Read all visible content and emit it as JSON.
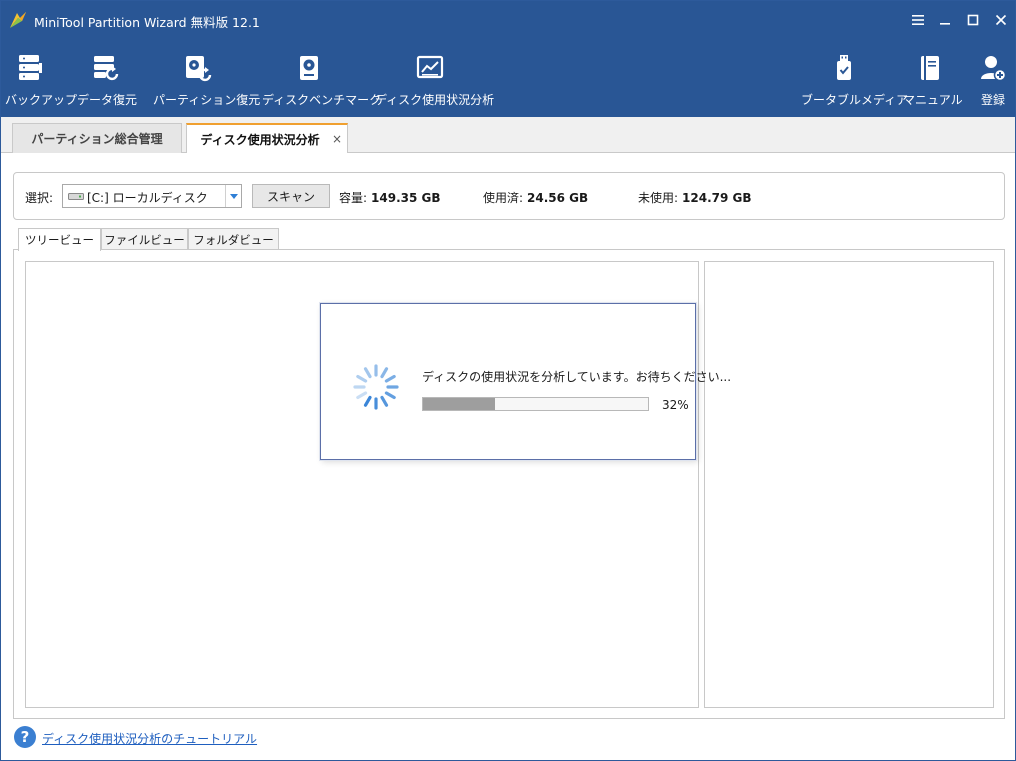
{
  "window": {
    "title": "MiniTool Partition Wizard 無料版 12.1"
  },
  "toolbar": {
    "left": [
      {
        "label": "バックアップ",
        "icon": "backup-icon"
      },
      {
        "label": "データ復元",
        "icon": "data-recovery-icon"
      },
      {
        "label": "パーティション復元",
        "icon": "partition-recovery-icon"
      },
      {
        "label": "ディスクベンチマーク",
        "icon": "disk-benchmark-icon"
      },
      {
        "label": "ディスク使用状況分析",
        "icon": "space-analyzer-icon"
      }
    ],
    "right": [
      {
        "label": "ブータブルメディア",
        "icon": "bootable-media-icon"
      },
      {
        "label": "マニュアル",
        "icon": "manual-icon"
      },
      {
        "label": "登録",
        "icon": "register-icon"
      }
    ]
  },
  "main_tabs": [
    {
      "label": "パーティション総合管理",
      "active": false
    },
    {
      "label": "ディスク使用状況分析",
      "active": true,
      "close": "×"
    }
  ],
  "select_panel": {
    "label": "選択:",
    "drive": "[C:] ローカルディスク",
    "scan_label": "スキャン",
    "capacity_label": "容量:",
    "capacity_value": "149.35 GB",
    "used_label": "使用済:",
    "used_value": "24.56 GB",
    "free_label": "未使用:",
    "free_value": "124.79 GB"
  },
  "sub_tabs": [
    {
      "label": "ツリービュー",
      "active": true
    },
    {
      "label": "ファイルビュー",
      "active": false
    },
    {
      "label": "フォルダビュー",
      "active": false
    }
  ],
  "dialog": {
    "message": "ディスクの使用状況を分析しています。お待ちください...",
    "progress": 32,
    "progress_label": "32%"
  },
  "footer": {
    "help_link": "ディスク使用状況分析のチュートリアル",
    "help_icon": "?"
  },
  "colors": {
    "toolbar_bg": "#295695",
    "accent_tab": "#f0a030",
    "spinner": "#2f7fd6",
    "link": "#1f5fbf"
  }
}
